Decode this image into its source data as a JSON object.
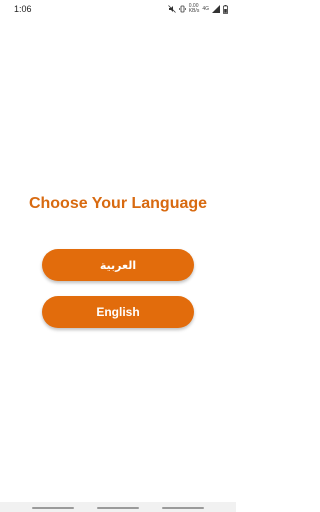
{
  "status_bar": {
    "time": "1:06",
    "net_speed_top": "0.00",
    "net_speed_bottom": "KB/s",
    "network_type": "4G",
    "icons": [
      "mute-icon",
      "vibrate-icon",
      "signal-icon",
      "battery-icon"
    ]
  },
  "main": {
    "title": "Choose Your Language",
    "buttons": [
      {
        "label": "العربية"
      },
      {
        "label": "English"
      }
    ]
  },
  "colors": {
    "accent": "#e26c0c",
    "title": "#d86a10",
    "background": "#ffffff"
  }
}
